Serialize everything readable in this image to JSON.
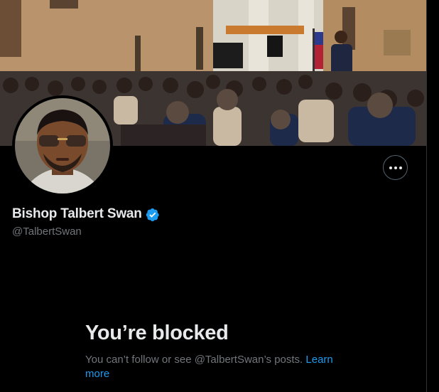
{
  "profile": {
    "display_name": "Bishop Talbert Swan",
    "handle": "@TalbertSwan",
    "verified": true,
    "verified_icon": "verified-badge-icon"
  },
  "header": {
    "more_icon": "more-horizontal-icon"
  },
  "blocked": {
    "title": "You’re blocked",
    "message": "You can’t follow or see @TalbertSwan’s posts.",
    "link_label": "Learn more"
  },
  "colors": {
    "background": "#000000",
    "primary_text": "#e7e9ea",
    "secondary_text": "#71767b",
    "accent": "#1d9bf0"
  }
}
